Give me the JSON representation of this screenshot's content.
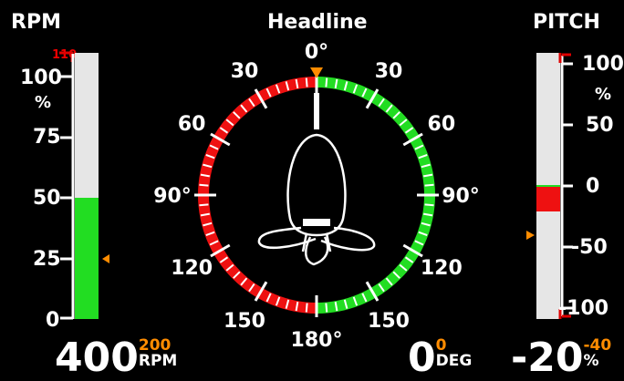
{
  "rpm": {
    "title": "RPM",
    "scale_max_label": "110",
    "ticks": [
      "100",
      "75",
      "50",
      "25",
      "0"
    ],
    "unit_label": "%",
    "value_percent": 50,
    "setpoint_percent": 24,
    "readout_value": "400",
    "readout_setpoint": "200",
    "readout_unit": "RPM",
    "colors": {
      "fill": "#22dd22",
      "track": "#e6e6e6",
      "limit": "#e00000",
      "marker": "#ff8c00"
    }
  },
  "headline": {
    "title": "Headline",
    "labels": [
      "0°",
      "30",
      "60",
      "90°",
      "120",
      "150",
      "180°",
      "150",
      "120",
      "90°",
      "60",
      "30"
    ],
    "readout_value": "0",
    "readout_setpoint": "0",
    "readout_unit": "DEG",
    "icon": "propeller-icon",
    "colors": {
      "port": "#ee1111",
      "starboard": "#22dd22",
      "marker": "#ff8c00"
    }
  },
  "pitch": {
    "title": "PITCH",
    "ticks": [
      "100",
      "50",
      "0",
      "-50",
      "-100"
    ],
    "unit_label": "%",
    "value_percent": -20,
    "setpoint_percent": -40,
    "readout_value": "-20",
    "readout_setpoint": "-40",
    "readout_unit": "%",
    "colors": {
      "fill": "#ee1111",
      "track": "#e6e6e6",
      "limit": "#e00000",
      "marker": "#ff8c00",
      "zero": "#22dd22"
    }
  }
}
